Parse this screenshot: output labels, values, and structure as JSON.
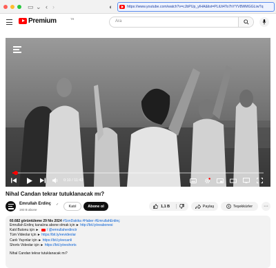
{
  "browser": {
    "url": "https://www.youtube.com/watch?v=cJbPUp_yIHA&list=PLiUt4To7hYYV8WMGGLiwTq"
  },
  "header": {
    "logo_text": "Premium",
    "logo_country": "TR",
    "search_placeholder": "Ara"
  },
  "player": {
    "time": "0:10 / 11:42",
    "progress_fraction": 0.014
  },
  "video": {
    "title": "Nihal Candan tekrar tutuklanacak mı?",
    "channel_name": "Emrullah Erdinç",
    "subscriber_count": "193 B abone",
    "join_label": "Katıl",
    "subscribed_label": "Abone ol",
    "like_count": "1,1 B",
    "share_label": "Paylaş",
    "thanks_label": "Teşekkürler"
  },
  "description": {
    "views_date": "60.682 görüntüleme  29 Nis 2024",
    "hashtags": "#SonDakika #Haber #EmrullahErdinç",
    "line1_text": "Emrullah Erdinç kanalına abone olmak için ► ",
    "line1_link": "http://bit.ly/eeabonesi",
    "line2_text": "Katıl Butonu için ► ",
    "line2_link": "/ @emrullaherdinctr",
    "line3_text": "Tüm Videolar için ► ",
    "line3_link": "https://bit.ly/eevideolar",
    "line4_text": "Canlı Yayınlar için ► ",
    "line4_link": "https://bit.ly/eecanli",
    "line5_text": "Shorts Videolar için ► ",
    "line5_link": "https://bit.ly/eeshorts",
    "repeat_title": "Nihal Candan tekrar tutuklanacak mı?"
  },
  "colors": {
    "accent_red": "#ff0000",
    "link_blue": "#065fd4"
  },
  "icons": [
    "menu-icon",
    "search-icon",
    "mic-icon",
    "play-icon",
    "next-icon",
    "volume-icon",
    "subtitles-icon",
    "settings-icon",
    "miniplayer-icon",
    "theater-icon",
    "cast-icon",
    "fullscreen-icon",
    "like-icon",
    "dislike-icon",
    "share-icon",
    "thanks-icon",
    "more-icon"
  ]
}
